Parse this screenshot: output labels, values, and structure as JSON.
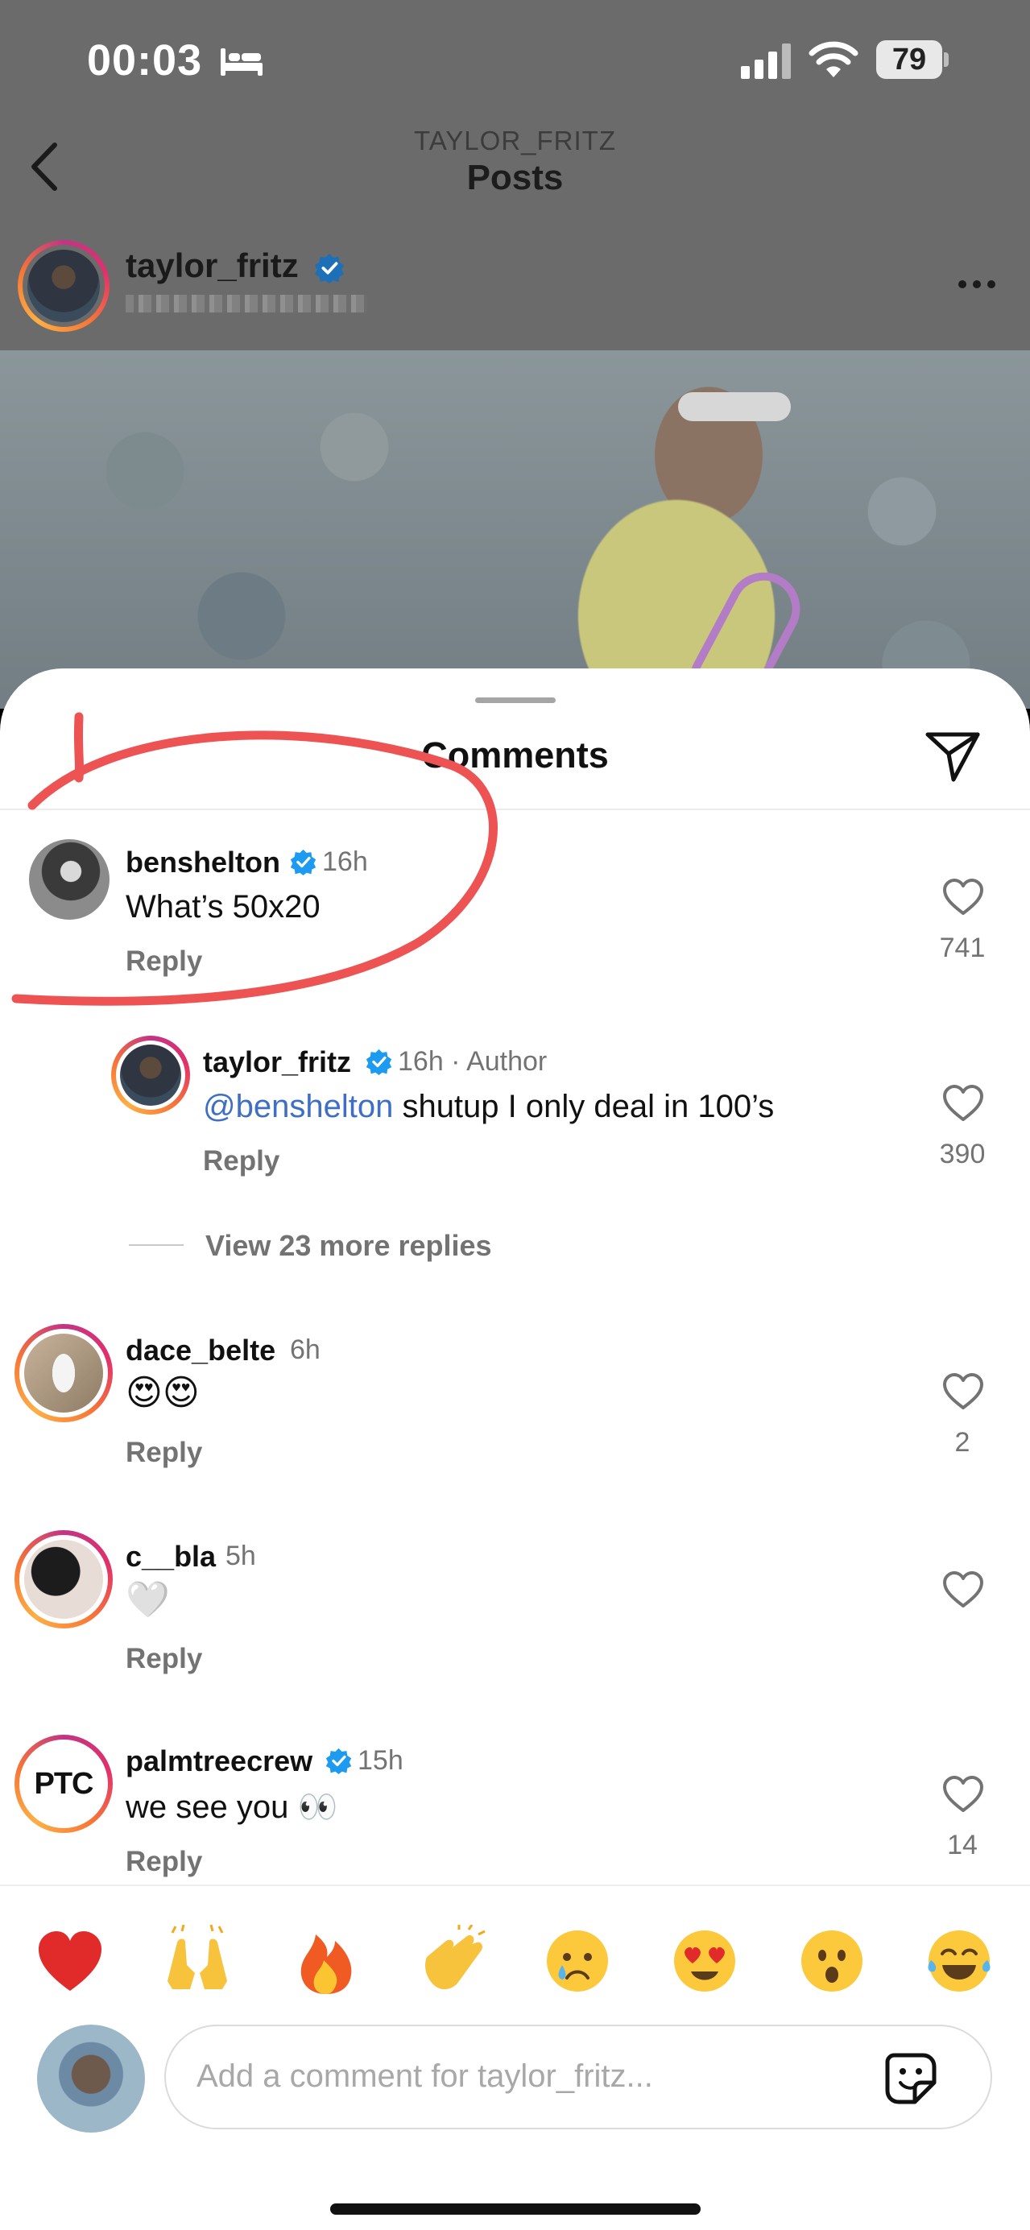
{
  "status_bar": {
    "time": "00:03",
    "battery": "79",
    "icons": [
      "bed-icon",
      "signal-icon",
      "wifi-icon",
      "battery-icon"
    ]
  },
  "header": {
    "subtitle": "TAYLOR_FRITZ",
    "title": "Posts",
    "back_icon": "chevron-left-icon"
  },
  "post": {
    "username": "taylor_fritz",
    "verified": true,
    "more_icon": "more-horizontal-icon"
  },
  "sheet": {
    "title": "Comments",
    "share_icon": "paper-plane-icon"
  },
  "comments": [
    {
      "username": "benshelton",
      "verified": true,
      "time": "16h",
      "text": "What’s 50x20",
      "reply_label": "Reply",
      "likes": "741"
    },
    {
      "username": "taylor_fritz",
      "verified": true,
      "time": "16h · Author",
      "mention": "@benshelton",
      "text": " shutup I only deal in 100’s",
      "reply_label": "Reply",
      "likes": "390"
    },
    {
      "username": "dace_belte",
      "verified": false,
      "time": "6h",
      "text": "😍😍",
      "reply_label": "Reply",
      "likes": "2"
    },
    {
      "username": "c__bla",
      "verified": false,
      "time": "5h",
      "text": "🤍",
      "reply_label": "Reply",
      "likes": ""
    },
    {
      "username": "palmtreecrew",
      "verified": true,
      "time": "15h",
      "text": "we see you 👀",
      "reply_label": "Reply",
      "likes": "14",
      "avatar_text": "PTC"
    }
  ],
  "view_replies": "View 23 more replies",
  "quick_emojis": [
    "❤️",
    "🙌",
    "🔥",
    "👏",
    "😢",
    "😍",
    "😮",
    "😂"
  ],
  "input": {
    "placeholder": "Add a comment for taylor_fritz..."
  },
  "colors": {
    "accent_mention": "#3e6fc4",
    "verified": "#1d9bf0",
    "annotation": "#ee5353",
    "muted": "#737373"
  }
}
